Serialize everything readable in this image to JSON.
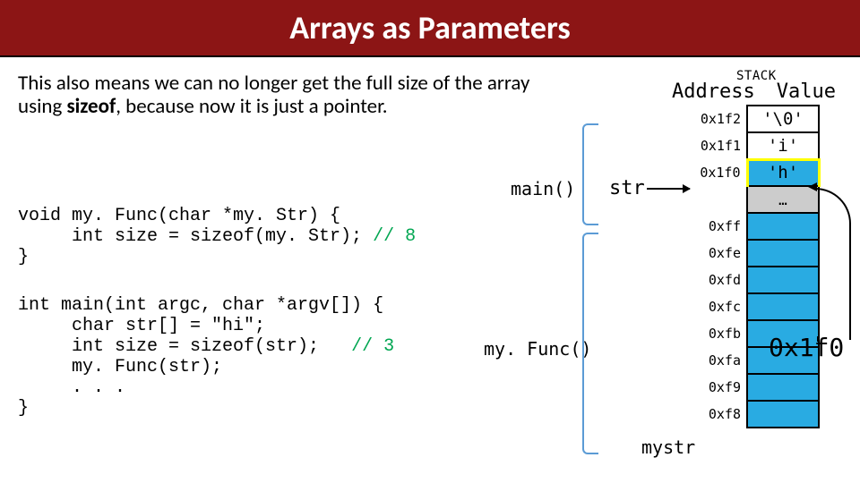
{
  "title": "Arrays as Parameters",
  "body": "This also means we can no longer get the full size of the array using sizeof, because now it is just a pointer.",
  "labels": {
    "main": "main()",
    "myfunc": "my. Func()",
    "str": "str",
    "mystr": "mystr"
  },
  "stack": {
    "caption": "STACK",
    "headers": {
      "addr": "Address",
      "val": "Value"
    },
    "rows": [
      {
        "addr": "0x1f2",
        "val": "'\\0'",
        "cls": ""
      },
      {
        "addr": "0x1f1",
        "val": "'i'",
        "cls": ""
      },
      {
        "addr": "0x1f0",
        "val": "'h'",
        "cls": "row-hi"
      },
      {
        "addr": "",
        "val": "…",
        "cls": "row-dots"
      },
      {
        "addr": "0xff",
        "val": "",
        "cls": "row-blue"
      },
      {
        "addr": "0xfe",
        "val": "",
        "cls": "row-blue"
      },
      {
        "addr": "0xfd",
        "val": "",
        "cls": "row-blue"
      },
      {
        "addr": "0xfc",
        "val": "",
        "cls": "row-blue"
      },
      {
        "addr": "0xfb",
        "val": "",
        "cls": "row-blue"
      },
      {
        "addr": "0xfa",
        "val": "",
        "cls": "row-blue"
      },
      {
        "addr": "0xf9",
        "val": "",
        "cls": "row-blue"
      },
      {
        "addr": "0xf8",
        "val": "",
        "cls": "row-blue"
      }
    ],
    "big_addr": "0x1f0"
  },
  "code": {
    "myfunc_line1": "void my. Func(char *my. Str) {",
    "myfunc_line2": "     int size = sizeof(my. Str); ",
    "myfunc_comment": "// 8",
    "myfunc_line3": "}",
    "main_line1": "int main(int argc, char *argv[]) {",
    "main_line2": "     char str[] = \"hi\";",
    "main_line3": "     int size = sizeof(str);   ",
    "main_comment": "// 3",
    "main_line4": "     my. Func(str);",
    "main_line5": "     . . .",
    "main_line6": "}"
  }
}
